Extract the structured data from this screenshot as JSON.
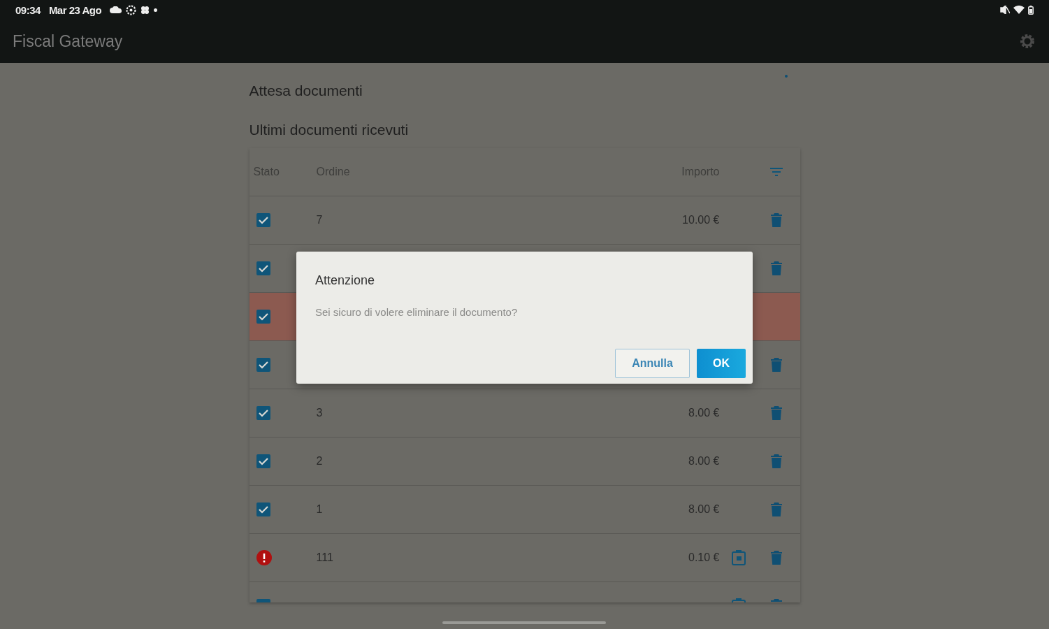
{
  "status_bar": {
    "time": "09:34",
    "date": "Mar 23 Ago"
  },
  "app_bar": {
    "title": "Fiscal Gateway"
  },
  "page": {
    "title": "Attesa documenti",
    "subtitle": "Ultimi documenti ricevuti"
  },
  "table": {
    "columns": [
      "Stato",
      "Ordine",
      "Importo"
    ],
    "rows": [
      {
        "kind": "done",
        "order": "7",
        "amount": "10.00 €",
        "highlighted": false,
        "receipt": false,
        "deletable": true
      },
      {
        "kind": "done",
        "highlighted": false,
        "receipt": false,
        "deletable": true
      },
      {
        "kind": "done",
        "highlighted": true,
        "receipt": false,
        "deletable": false
      },
      {
        "kind": "done",
        "highlighted": false,
        "receipt": false,
        "deletable": true
      },
      {
        "kind": "done",
        "order": "3",
        "amount": "8.00 €",
        "highlighted": false,
        "receipt": false,
        "deletable": true
      },
      {
        "kind": "done",
        "order": "2",
        "amount": "8.00 €",
        "highlighted": false,
        "receipt": false,
        "deletable": true
      },
      {
        "kind": "done",
        "order": "1",
        "amount": "8.00 €",
        "highlighted": false,
        "receipt": false,
        "deletable": true
      },
      {
        "kind": "error",
        "order": "111",
        "amount": "0.10 €",
        "highlighted": false,
        "receipt": true,
        "deletable": true
      },
      {
        "kind": "done",
        "highlighted": false,
        "receipt": true,
        "deletable": true
      }
    ]
  },
  "dialog": {
    "title": "Attenzione",
    "message": "Sei sicuro di volere eliminare il documento?",
    "buttons": [
      {
        "label": "Annulla",
        "kind": "outlined"
      },
      {
        "label": "OK",
        "kind": "filled"
      }
    ]
  }
}
